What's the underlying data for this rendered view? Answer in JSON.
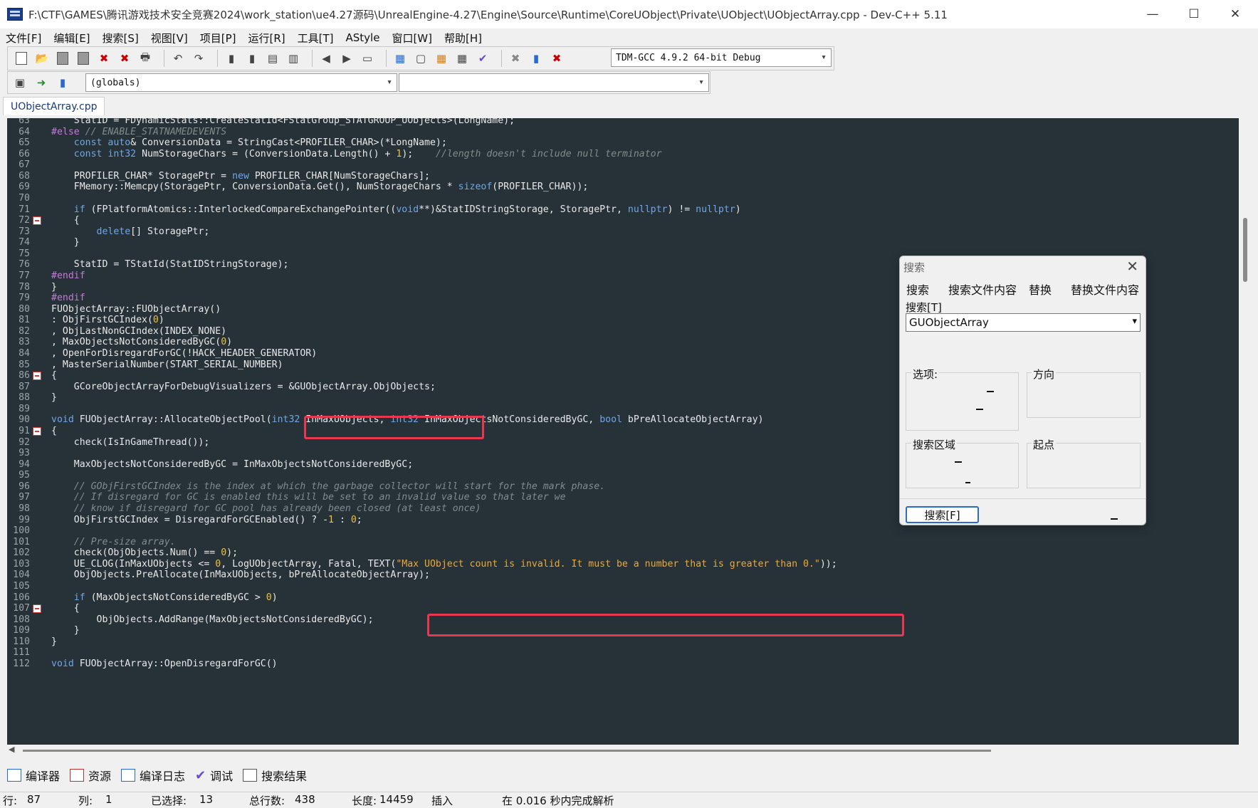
{
  "window": {
    "title": "F:\\CTF\\GAMES\\腾讯游戏技术安全竞赛2024\\work_station\\ue4.27源码\\UnrealEngine-4.27\\Engine\\Source\\Runtime\\CoreUObject\\Private\\UObject\\UObjectArray.cpp - Dev-C++ 5.11"
  },
  "menu": [
    "文件[F]",
    "编辑[E]",
    "搜索[S]",
    "视图[V]",
    "项目[P]",
    "运行[R]",
    "工具[T]",
    "AStyle",
    "窗口[W]",
    "帮助[H]"
  ],
  "toolbar": {
    "compiler": "TDM-GCC 4.9.2 64-bit Debug",
    "scope": "(globals)",
    "function": ""
  },
  "file_tab": "UObjectArray.cpp",
  "code": [
    {
      "n": "63",
      "t": "    StatID = FDynamicStats::CreateStatId<FStatGroup_STATGROUP_UObjects>(LongName);"
    },
    {
      "n": "64",
      "t": "#else // ENABLE_STATNAMEDEVENTS"
    },
    {
      "n": "65",
      "t": "    const auto& ConversionData = StringCast<PROFILER_CHAR>(*LongName);"
    },
    {
      "n": "66",
      "t": "    const int32 NumStorageChars = (ConversionData.Length() + 1);    //length doesn't include null terminator"
    },
    {
      "n": "67",
      "t": ""
    },
    {
      "n": "68",
      "t": "    PROFILER_CHAR* StoragePtr = new PROFILER_CHAR[NumStorageChars];"
    },
    {
      "n": "69",
      "t": "    FMemory::Memcpy(StoragePtr, ConversionData.Get(), NumStorageChars * sizeof(PROFILER_CHAR));"
    },
    {
      "n": "70",
      "t": ""
    },
    {
      "n": "71",
      "t": "    if (FPlatformAtomics::InterlockedCompareExchangePointer((void**)&StatIDStringStorage, StoragePtr, nullptr) != nullptr)"
    },
    {
      "n": "72",
      "t": "    {"
    },
    {
      "n": "73",
      "t": "        delete[] StoragePtr;"
    },
    {
      "n": "74",
      "t": "    }"
    },
    {
      "n": "75",
      "t": ""
    },
    {
      "n": "76",
      "t": "    StatID = TStatId(StatIDStringStorage);"
    },
    {
      "n": "77",
      "t": "#endif"
    },
    {
      "n": "78",
      "t": "}"
    },
    {
      "n": "79",
      "t": "#endif"
    },
    {
      "n": "80",
      "t": "FUObjectArray::FUObjectArray()"
    },
    {
      "n": "81",
      "t": ": ObjFirstGCIndex(0)"
    },
    {
      "n": "82",
      "t": ", ObjLastNonGCIndex(INDEX_NONE)"
    },
    {
      "n": "83",
      "t": ", MaxObjectsNotConsideredByGC(0)"
    },
    {
      "n": "84",
      "t": ", OpenForDisregardForGC(!HACK_HEADER_GENERATOR)"
    },
    {
      "n": "85",
      "t": ", MasterSerialNumber(START_SERIAL_NUMBER)"
    },
    {
      "n": "86",
      "t": "{"
    },
    {
      "n": "87",
      "t": "    GCoreObjectArrayForDebugVisualizers = &GUObjectArray.ObjObjects;"
    },
    {
      "n": "88",
      "t": "}"
    },
    {
      "n": "89",
      "t": ""
    },
    {
      "n": "90",
      "t": "void FUObjectArray::AllocateObjectPool(int32 InMaxUObjects, int32 InMaxObjectsNotConsideredByGC, bool bPreAllocateObjectArray)"
    },
    {
      "n": "91",
      "t": "{"
    },
    {
      "n": "92",
      "t": "    check(IsInGameThread());"
    },
    {
      "n": "93",
      "t": ""
    },
    {
      "n": "94",
      "t": "    MaxObjectsNotConsideredByGC = InMaxObjectsNotConsideredByGC;"
    },
    {
      "n": "95",
      "t": ""
    },
    {
      "n": "96",
      "t": "    // GObjFirstGCIndex is the index at which the garbage collector will start for the mark phase."
    },
    {
      "n": "97",
      "t": "    // If disregard for GC is enabled this will be set to an invalid value so that later we"
    },
    {
      "n": "98",
      "t": "    // know if disregard for GC pool has already been closed (at least once)"
    },
    {
      "n": "99",
      "t": "    ObjFirstGCIndex = DisregardForGCEnabled() ? -1 : 0;"
    },
    {
      "n": "100",
      "t": ""
    },
    {
      "n": "101",
      "t": "    // Pre-size array."
    },
    {
      "n": "102",
      "t": "    check(ObjObjects.Num() == 0);"
    },
    {
      "n": "103",
      "t": "    UE_CLOG(InMaxUObjects <= 0, LogUObjectArray, Fatal, TEXT(\"Max UObject count is invalid. It must be a number that is greater than 0.\"));"
    },
    {
      "n": "104",
      "t": "    ObjObjects.PreAllocate(InMaxUObjects, bPreAllocateObjectArray);"
    },
    {
      "n": "105",
      "t": ""
    },
    {
      "n": "106",
      "t": "    if (MaxObjectsNotConsideredByGC > 0)"
    },
    {
      "n": "107",
      "t": "    {"
    },
    {
      "n": "108",
      "t": "        ObjObjects.AddRange(MaxObjectsNotConsideredByGC);"
    },
    {
      "n": "109",
      "t": "    }"
    },
    {
      "n": "110",
      "t": "}"
    },
    {
      "n": "111",
      "t": ""
    },
    {
      "n": "112",
      "t": "void FUObjectArray::OpenDisregardForGC()"
    }
  ],
  "bottom_tabs": [
    "编译器",
    "资源",
    "编译日志",
    "调试",
    "搜索结果"
  ],
  "status": {
    "row_label": "行:",
    "row": "87",
    "col_label": "列:",
    "col": "1",
    "sel_label": "已选择:",
    "sel": "13",
    "lines_label": "总行数:",
    "lines": "438",
    "len_label": "长度:",
    "len": "14459",
    "mode": "插入",
    "parse": "在 0.016 秒内完成解析"
  },
  "search_dialog": {
    "title": "搜索",
    "tabs": [
      "搜索",
      "搜索文件内容",
      "替换",
      "替换文件内容"
    ],
    "find_label": "搜索[T]",
    "find_value": "GUObjectArray",
    "options_label": "选项:",
    "direction_label": "方向",
    "scope_label": "搜索区域",
    "origin_label": "起点",
    "search_button": "搜索[F]"
  }
}
